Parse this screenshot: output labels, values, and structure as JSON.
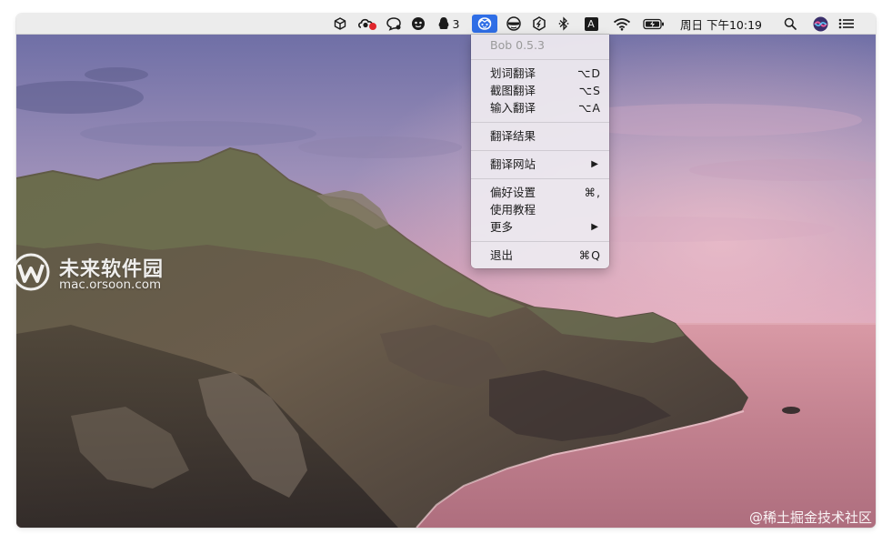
{
  "menubar": {
    "status_items": [
      {
        "icon": "cube-icon"
      },
      {
        "icon": "cloud-sync-badge-icon"
      },
      {
        "icon": "chat-bubble-icon"
      },
      {
        "icon": "face-icon"
      },
      {
        "icon": "qq-penguin-icon",
        "badge": "3"
      },
      {
        "icon": "bob-app-icon",
        "active": true
      },
      {
        "icon": "mask-face-icon"
      },
      {
        "icon": "hexagon-icon"
      },
      {
        "icon": "bluetooth-icon"
      },
      {
        "icon": "input-source-icon",
        "label": "A"
      },
      {
        "icon": "wifi-icon"
      },
      {
        "icon": "battery-charging-icon"
      }
    ],
    "clock": "周日 下午10:19",
    "right_icons": [
      "spotlight-search-icon",
      "siri-icon",
      "control-center-icon"
    ]
  },
  "app_menu": {
    "items": [
      {
        "label": "Bob 0.5.3",
        "disabled": true
      },
      {
        "separator": true
      },
      {
        "label": "划词翻译",
        "shortcut": "⌥D"
      },
      {
        "label": "截图翻译",
        "shortcut": "⌥S"
      },
      {
        "label": "输入翻译",
        "shortcut": "⌥A"
      },
      {
        "separator": true
      },
      {
        "label": "翻译结果"
      },
      {
        "separator": true
      },
      {
        "label": "翻译网站",
        "submenu": true
      },
      {
        "separator": true
      },
      {
        "label": "偏好设置",
        "shortcut": "⌘,"
      },
      {
        "label": "使用教程"
      },
      {
        "label": "更多",
        "submenu": true
      },
      {
        "separator": true
      },
      {
        "label": "退出",
        "shortcut": "⌘Q"
      }
    ]
  },
  "watermark": {
    "title": "未来软件园",
    "subtitle": "mac.orsoon.com"
  },
  "credit": "@稀土掘金技术社区",
  "colors": {
    "menubar_bg": "#ececec",
    "menu_highlight": "#2f6ee6",
    "menu_bg": "#ece8ee",
    "badge_red": "#e0262c"
  }
}
